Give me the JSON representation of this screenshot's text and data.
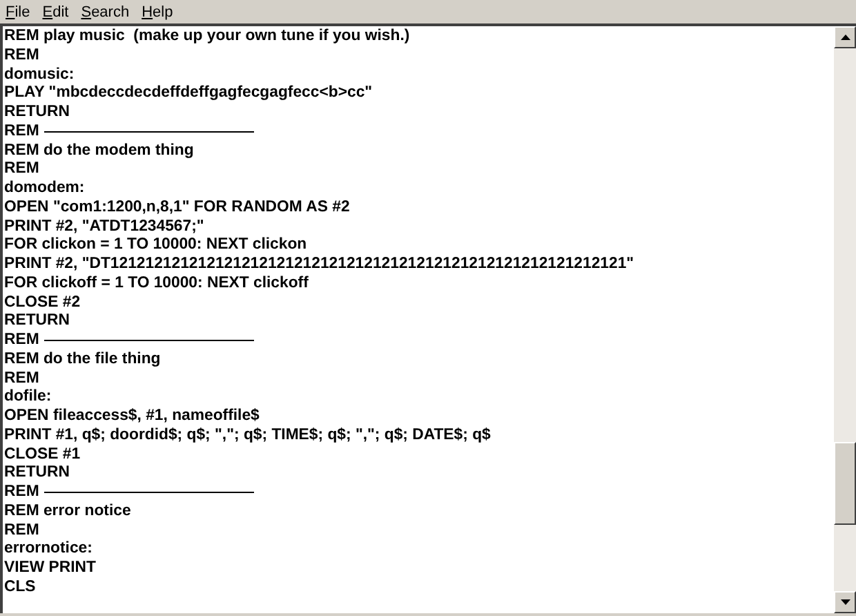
{
  "menu": [
    {
      "label": "File"
    },
    {
      "label": "Edit"
    },
    {
      "label": "Search"
    },
    {
      "label": "Help"
    }
  ],
  "lines": [
    {
      "kind": "code",
      "text": "REM play music  (make up your own tune if you wish.)"
    },
    {
      "kind": "code",
      "text": "REM"
    },
    {
      "kind": "code",
      "text": "domusic:"
    },
    {
      "kind": "code",
      "text": "PLAY \"mbcdeccdecdeffdeffgagfecgagfecc<b>cc\""
    },
    {
      "kind": "code",
      "text": "RETURN"
    },
    {
      "kind": "rule",
      "text": "REM"
    },
    {
      "kind": "code",
      "text": "REM do the modem thing"
    },
    {
      "kind": "code",
      "text": "REM"
    },
    {
      "kind": "code",
      "text": "domodem:"
    },
    {
      "kind": "code",
      "text": "OPEN \"com1:1200,n,8,1\" FOR RANDOM AS #2"
    },
    {
      "kind": "code",
      "text": "PRINT #2, \"ATDT1234567;\""
    },
    {
      "kind": "code",
      "text": "FOR clickon = 1 TO 10000: NEXT clickon"
    },
    {
      "kind": "code",
      "text": "PRINT #2, \"DT12121212121212121212121212121212121212121212121212121212121\""
    },
    {
      "kind": "code",
      "text": "FOR clickoff = 1 TO 10000: NEXT clickoff"
    },
    {
      "kind": "code",
      "text": "CLOSE #2"
    },
    {
      "kind": "code",
      "text": "RETURN"
    },
    {
      "kind": "rule",
      "text": "REM"
    },
    {
      "kind": "code",
      "text": "REM do the file thing"
    },
    {
      "kind": "code",
      "text": "REM"
    },
    {
      "kind": "code",
      "text": "dofile:"
    },
    {
      "kind": "code",
      "text": "OPEN fileaccess$, #1, nameoffile$"
    },
    {
      "kind": "code",
      "text": "PRINT #1, q$; doordid$; q$; \",\"; q$; TIME$; q$; \",\"; q$; DATE$; q$"
    },
    {
      "kind": "code",
      "text": "CLOSE #1"
    },
    {
      "kind": "code",
      "text": "RETURN"
    },
    {
      "kind": "rule",
      "text": "REM"
    },
    {
      "kind": "code",
      "text": "REM error notice"
    },
    {
      "kind": "code",
      "text": "REM"
    },
    {
      "kind": "code",
      "text": "errornotice:"
    },
    {
      "kind": "code",
      "text": "VIEW PRINT"
    },
    {
      "kind": "code",
      "text": "CLS"
    }
  ]
}
